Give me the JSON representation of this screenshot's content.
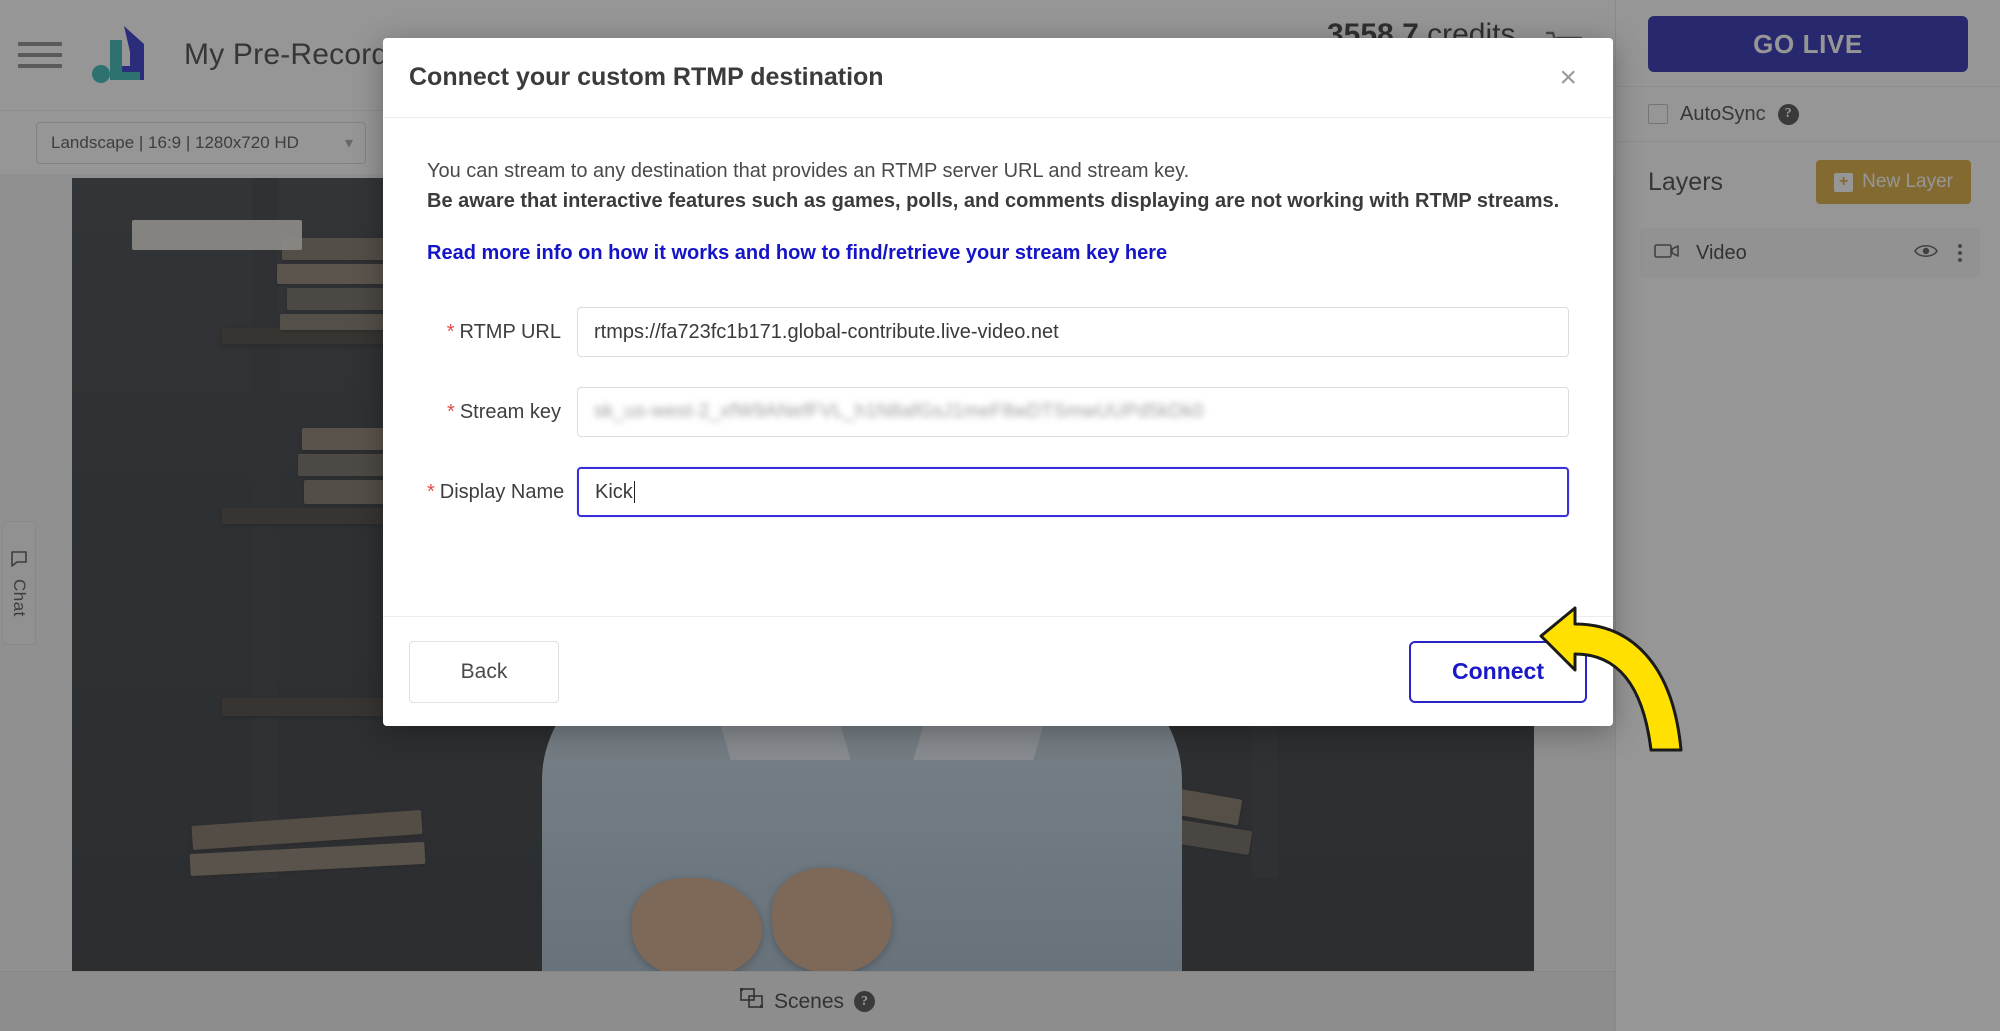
{
  "app": {
    "title": "My Pre-Recorded Stream",
    "menu_icon": "hamburger-icon",
    "logo_icon": "brand-logo-icon",
    "credits_value": "3558.7",
    "credits_unit": "credits",
    "cart_icon": "cart-icon",
    "resolution": "Landscape | 16:9 | 1280x720 HD",
    "chat_tab_label": "Chat",
    "chat_icon": "chat-bubble-icon",
    "scenes_label": "Scenes",
    "scenes_icon": "scenes-frames-icon",
    "scenes_help_icon": "help-circle-icon"
  },
  "right_panel": {
    "go_live_label": "GO LIVE",
    "autosync_label": "AutoSync",
    "autosync_help_icon": "help-circle-icon",
    "autosync_checked": false,
    "layers_title": "Layers",
    "new_layer_label": "New Layer",
    "new_layer_icon": "plus-square-icon",
    "layers": [
      {
        "name": "Video",
        "type_icon": "video-camera-icon",
        "visibility_icon": "eye-icon",
        "menu_icon": "kebab-menu-icon"
      }
    ]
  },
  "modal": {
    "title": "Connect your custom RTMP destination",
    "close_icon": "close-icon",
    "description_1": "You can stream to any destination that provides an RTMP server URL and stream key.",
    "description_2": "Be aware that interactive features such as games, polls, and comments displaying are not working with RTMP streams.",
    "info_link": "Read more info on how it works and how to find/retrieve your stream key here",
    "fields": [
      {
        "label": "RTMP URL",
        "required": true,
        "value": "rtmps://fa723fc1b171.global-contribute.live-video.net",
        "focused": false,
        "redacted": false
      },
      {
        "label": "Stream key",
        "required": true,
        "value": "sk_us-west-2_xfW9ANefFVL_h1N8afGsJ1meF8wDTSmwUUPd5kDk0",
        "focused": false,
        "redacted": true
      },
      {
        "label": "Display Name",
        "required": true,
        "value": "Kick",
        "focused": true,
        "redacted": false
      }
    ],
    "back_label": "Back",
    "connect_label": "Connect"
  },
  "annotation": {
    "arrow_icon": "yellow-pointer-arrow-icon",
    "arrow_color": "#FFE000"
  },
  "colors": {
    "go_live_bg": "#0D0DA6",
    "new_layer_bg": "#D69E1E",
    "link": "#1414C8",
    "connect_border": "#2A25C4",
    "required_star": "#E34A4A",
    "focus_border": "#3A2FD8",
    "annotation_yellow": "#FFE000"
  }
}
